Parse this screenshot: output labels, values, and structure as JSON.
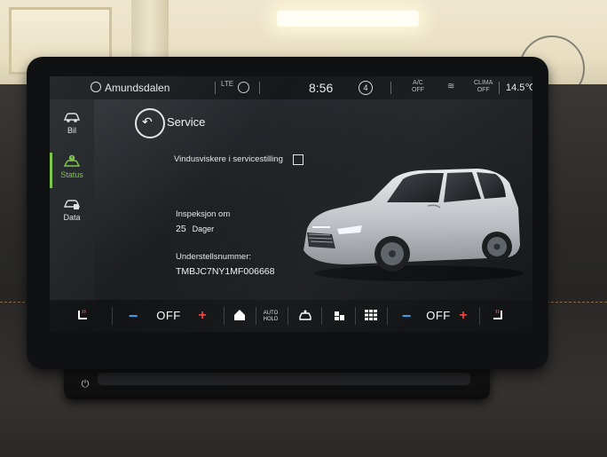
{
  "status_bar": {
    "location": "Amundsdalen",
    "signal": "LTE",
    "time": "8:56",
    "notification_count": "4",
    "ac_label_line1": "A/C",
    "ac_label_line2": "OFF",
    "clima_label_line1": "CLIMA",
    "clima_label_line2": "OFF",
    "outside_temp": "14.5℃"
  },
  "sidebar": {
    "items": [
      {
        "label": "Bil",
        "icon": "car-icon",
        "active": false
      },
      {
        "label": "Status",
        "icon": "car-status-icon",
        "active": true
      },
      {
        "label": "Data",
        "icon": "data-icon",
        "active": false
      }
    ]
  },
  "page": {
    "title": "Service",
    "wiper_service_label": "Vindusviskere i servicestilling",
    "wiper_service_checked": false,
    "inspection_label": "Inspeksjon om",
    "inspection_value": "25",
    "inspection_unit": "Dager",
    "vin_label": "Understellsnummer:",
    "vin_value": "TMBJC7NY1MF006668"
  },
  "climate_bar": {
    "left_temp": "OFF",
    "right_temp": "OFF",
    "minus_symbol": "−",
    "plus_symbol": "+",
    "auto_hold_line1": "AUTO",
    "auto_hold_line2": "HOLD",
    "icons": [
      "seat-heat-left-icon",
      "home-icon",
      "auto-hold-icon",
      "camera-icon",
      "apps-icon",
      "menu-grid-icon",
      "seat-heat-right-icon"
    ]
  },
  "colors": {
    "accent_green": "#78c443",
    "minus_blue": "#3aa0e8",
    "plus_red": "#e84141",
    "screen_bg": "#1b1d20"
  }
}
